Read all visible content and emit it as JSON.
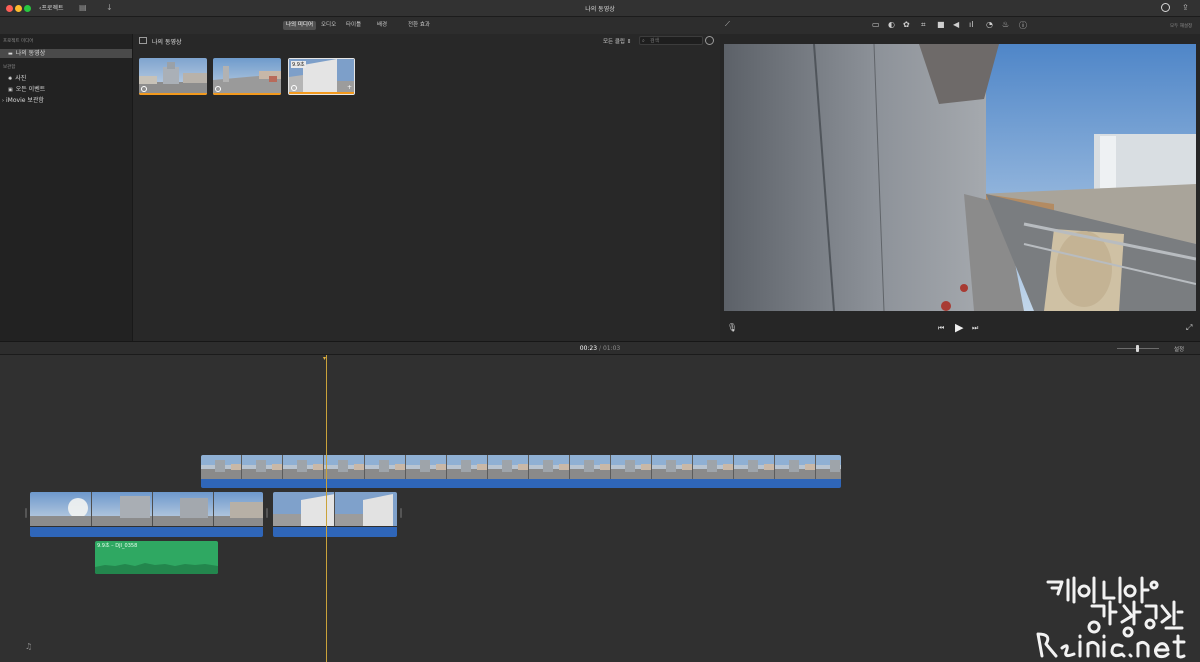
{
  "window": {
    "title": "나의 동영상",
    "back_label": "프로젝트",
    "colors": {
      "accent_orange": "#f39a1e",
      "audio_blue": "#2f66b9",
      "bg_audio_green": "#2fa862",
      "playhead": "#c9a23a"
    }
  },
  "media_tabs": [
    {
      "label": "나의 미디어",
      "active": true
    },
    {
      "label": "오디오",
      "active": false
    },
    {
      "label": "타이틀",
      "active": false
    },
    {
      "label": "배경",
      "active": false
    },
    {
      "label": "전환 효과",
      "active": false
    }
  ],
  "viewer_tools": [
    "display-icon",
    "color-balance-icon",
    "color-palette-icon",
    "crop-icon",
    "camera-stabilization-icon",
    "volume-icon",
    "equalizer-icon",
    "speed-icon",
    "noise-reduction-icon",
    "info-icon"
  ],
  "viewer": {
    "reset_label": "모두 재설정"
  },
  "sidebar": {
    "section_projects": "프로젝트 미디어",
    "project_item": "나의 동영상",
    "section_libraries": "보관함",
    "library_items": [
      "사진",
      "오든 이벤트"
    ],
    "imovie_library": "iMovie 보관함"
  },
  "browser": {
    "event_title": "나의 동영상",
    "filter": "모든 클립",
    "search_placeholder": "검색",
    "thumbs": [
      {
        "badge": ""
      },
      {
        "badge": ""
      },
      {
        "badge": "9.9초"
      }
    ]
  },
  "timeline": {
    "current_time": "00:23",
    "separator": "/",
    "total_time": "01:03",
    "settings_label": "설정",
    "audio_clip_label": "9.9초 – DJI_0358"
  }
}
